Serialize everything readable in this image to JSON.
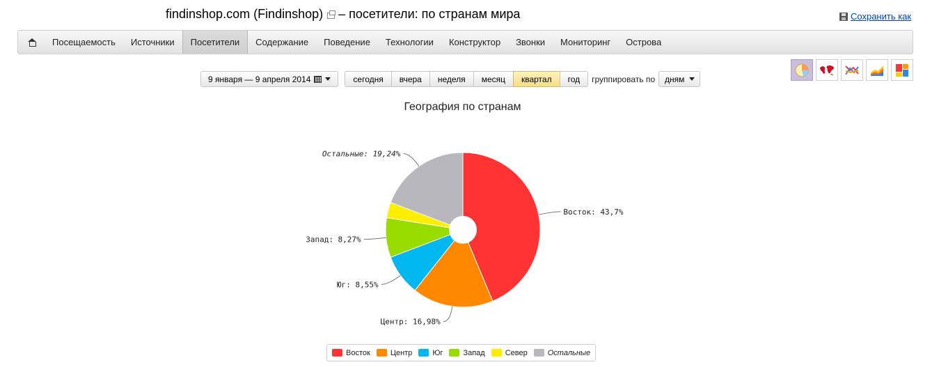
{
  "header": {
    "site_title": "findinshop.com (Findinshop)",
    "subtitle": "– посетители: по странам мира",
    "save_label": "Сохранить как"
  },
  "navbar": {
    "home_icon": "home-icon",
    "items": [
      {
        "label": "Посещаемость",
        "active": false
      },
      {
        "label": "Источники",
        "active": false
      },
      {
        "label": "Посетители",
        "active": true
      },
      {
        "label": "Содержание",
        "active": false
      },
      {
        "label": "Поведение",
        "active": false
      },
      {
        "label": "Технологии",
        "active": false
      },
      {
        "label": "Конструктор",
        "active": false
      },
      {
        "label": "Звонки",
        "active": false
      },
      {
        "label": "Мониторинг",
        "active": false
      },
      {
        "label": "Острова",
        "active": false
      }
    ]
  },
  "controls": {
    "date_range": "9 января — 9 апреля 2014",
    "periods": [
      {
        "label": "сегодня",
        "active": false
      },
      {
        "label": "вчера",
        "active": false
      },
      {
        "label": "неделя",
        "active": false
      },
      {
        "label": "месяц",
        "active": false
      },
      {
        "label": "квартал",
        "active": true
      },
      {
        "label": "год",
        "active": false
      }
    ],
    "group_label": "группировать по",
    "group_value": "дням"
  },
  "view_icons": [
    {
      "icon": "pie-chart-icon",
      "active": true
    },
    {
      "icon": "world-map-icon",
      "active": false
    },
    {
      "icon": "line-chart-icon",
      "active": false
    },
    {
      "icon": "area-chart-icon",
      "active": false
    },
    {
      "icon": "treemap-icon",
      "active": false
    }
  ],
  "chart_data": {
    "type": "pie",
    "title": "География по странам",
    "slices": [
      {
        "name": "Восток",
        "value": 43.7,
        "label": "Восток: 43,7%",
        "color": "#ff3333"
      },
      {
        "name": "Центр",
        "value": 16.98,
        "label": "Центр: 16,98%",
        "color": "#ff8800"
      },
      {
        "name": "Юг",
        "value": 8.55,
        "label": "Юг: 8,55%",
        "color": "#00b7f0"
      },
      {
        "name": "Запад",
        "value": 8.27,
        "label": "Запад: 8,27%",
        "color": "#99dd00"
      },
      {
        "name": "Север",
        "value": 3.26,
        "label": "",
        "color": "#ffee00"
      },
      {
        "name": "Остальные",
        "value": 19.24,
        "label": "Остальные: 19,24%",
        "color": "#b7b7bd",
        "italic": true
      }
    ],
    "legend_position": "bottom"
  }
}
